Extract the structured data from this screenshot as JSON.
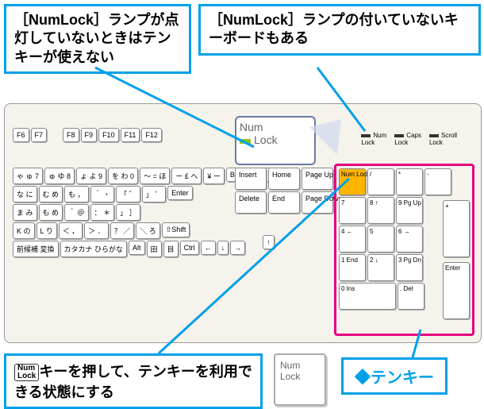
{
  "callouts": {
    "top_left": "［NumLock］ランプが点灯していないときはテンキーが使えない",
    "top_right": "［NumLock］ランプの付いていないキーボードもある",
    "bottom": "キーを押して、テンキーを利用できる状態にする",
    "tenkey_label": "◆テンキー"
  },
  "numlock_zoom": {
    "line1": "Num",
    "line2": "Lock"
  },
  "big_numlock": {
    "line1": "Num",
    "line2": "Lock"
  },
  "inline_numlock": {
    "line1": "Num",
    "line2": "Lock"
  },
  "indicators": [
    {
      "label": "Num Lock"
    },
    {
      "label": "Caps Lock"
    },
    {
      "label": "Scroll Lock"
    }
  ],
  "fn_keys": [
    "F6",
    "F7",
    "F8",
    "F9",
    "F10",
    "F11",
    "F12"
  ],
  "main_rows": [
    [
      "ゃ ゅ 7",
      "ゅ ゆ 8",
      "ょ よ 9",
      "を わ 0",
      "～ = ほ",
      "ー £ へ",
      "¥ ー",
      "Back space"
    ],
    [
      "な に",
      "む め",
      "も ，",
      "＾ ・",
      "「 ゛",
      "」 ゜",
      "Enter"
    ],
    [
      "ま み",
      "も め",
      "＾ ＠",
      "： ＊",
      "」 ］"
    ],
    [
      "K の",
      "L り",
      "＜ ，",
      "＞ ．",
      "？ ／",
      "＼ ろ",
      "⇧Shift"
    ],
    [
      "前候補 変換",
      "カタカナ ひらがな",
      "Alt",
      "田",
      "目",
      "Ctrl",
      "←",
      "↓",
      "→"
    ]
  ],
  "nav_keys": [
    [
      "Insert",
      "Home",
      "Page Up"
    ],
    [
      "Delete",
      "End",
      "Page Down"
    ]
  ],
  "arrow_up": "↑",
  "tenkey": {
    "r1": [
      {
        "t": "Num Lock",
        "cls": "numlock-key"
      },
      {
        "t": "/"
      },
      {
        "t": "*"
      },
      {
        "t": "-"
      }
    ],
    "r2": [
      {
        "t": "7"
      },
      {
        "t": "8 ↑"
      },
      {
        "t": "9 Pg Up"
      }
    ],
    "r3": [
      {
        "t": "4 ←"
      },
      {
        "t": "5"
      },
      {
        "t": "6 →"
      }
    ],
    "r4": [
      {
        "t": "1 End"
      },
      {
        "t": "2 ↓"
      },
      {
        "t": "3 Pg Dn"
      }
    ],
    "r5": [
      {
        "t": "0 Ins",
        "cls": "tk-wide"
      },
      {
        "t": ". Del"
      }
    ],
    "plus": "+",
    "enter": "Enter"
  }
}
